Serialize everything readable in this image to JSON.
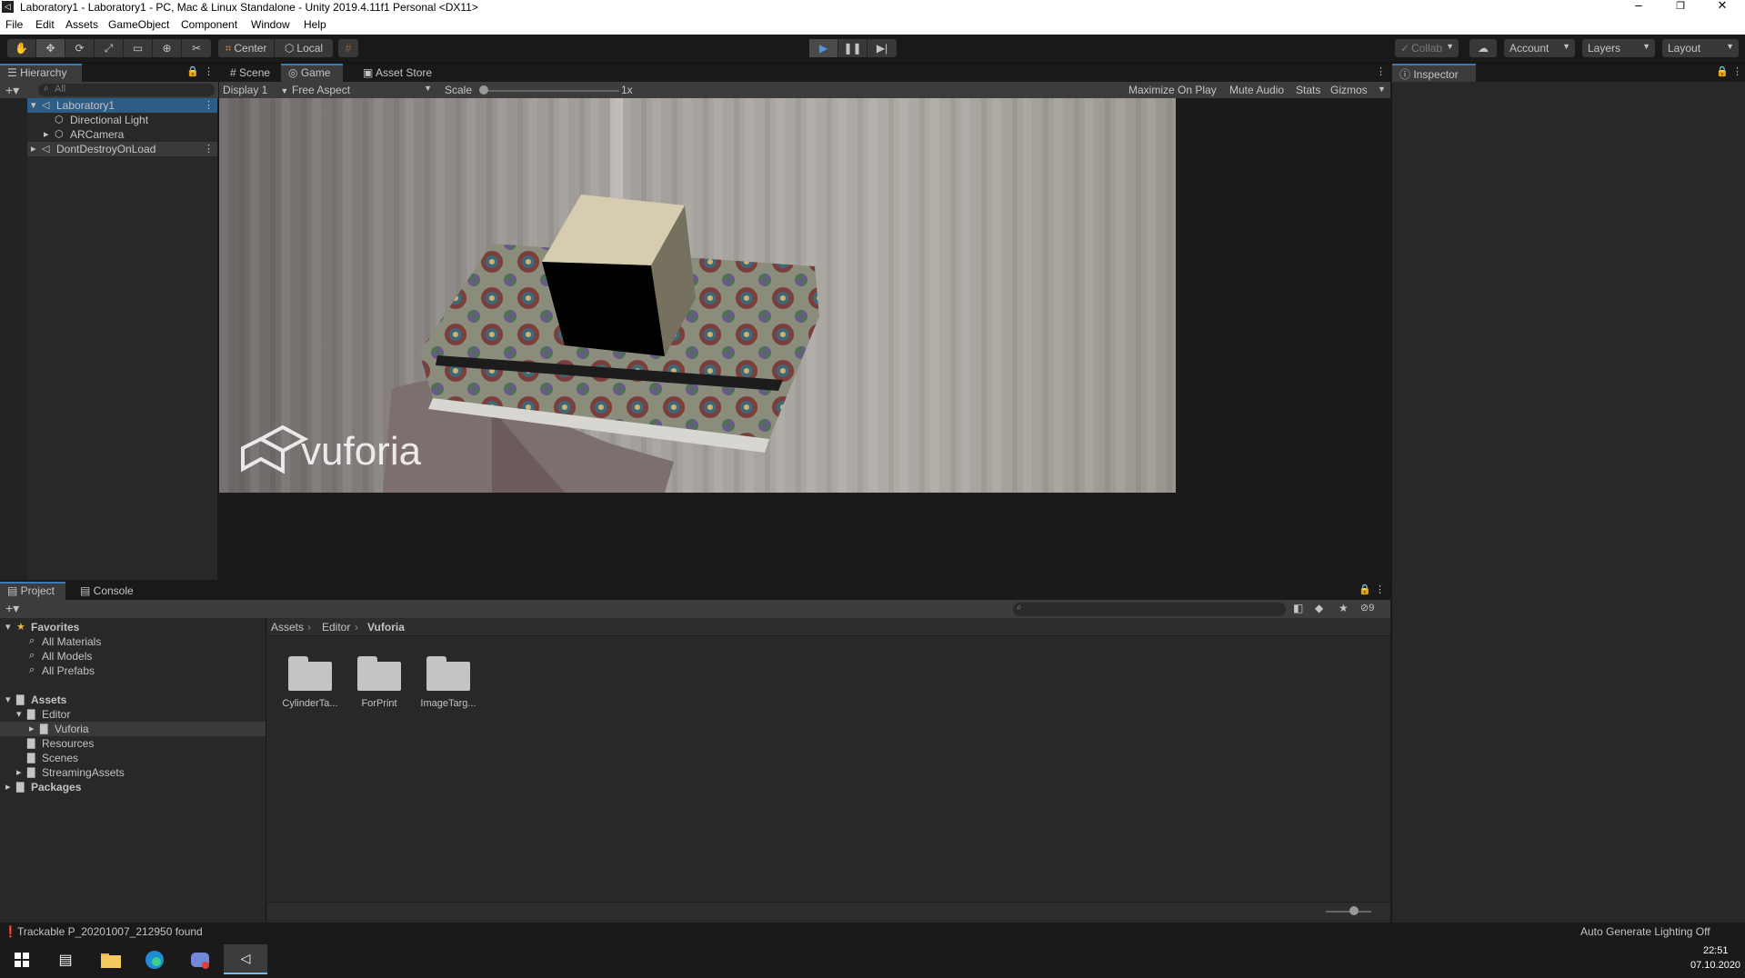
{
  "window": {
    "title": "Laboratory1 - Laboratory1 - PC, Mac & Linux Standalone - Unity 2019.4.11f1 Personal <DX11>",
    "app_icon": "◁",
    "minimize": "–",
    "restore": "❐",
    "close": "✕"
  },
  "menu": [
    "File",
    "Edit",
    "Assets",
    "GameObject",
    "Component",
    "Window",
    "Help"
  ],
  "toolbar": {
    "tools": [
      "hand-tool",
      "move-tool",
      "rotate-tool",
      "scale-tool",
      "rect-tool",
      "transform-tool",
      "custom-tool"
    ],
    "pivot": "Center",
    "space": "Local",
    "collab": "Collab",
    "account": "Account",
    "layers": "Layers",
    "layout": "Layout"
  },
  "hierarchy": {
    "tab": "Hierarchy",
    "search_placeholder": "All",
    "items": [
      {
        "label": "Laboratory1"
      },
      {
        "label": "Directional Light"
      },
      {
        "label": "ARCamera"
      },
      {
        "label": "DontDestroyOnLoad"
      }
    ]
  },
  "center_tabs": [
    "Scene",
    "Game",
    "Asset Store"
  ],
  "game_toolbar": {
    "display": "Display 1",
    "aspect": "Free Aspect",
    "scale_label": "Scale",
    "scale_value": "1x",
    "maximize": "Maximize On Play",
    "mute": "Mute Audio",
    "stats": "Stats",
    "gizmos": "Gizmos"
  },
  "game_view": {
    "watermark": "vuforia"
  },
  "inspector": {
    "tab": "Inspector"
  },
  "project": {
    "tabs": [
      "Project",
      "Console"
    ],
    "hidden_count": "9",
    "favorites": {
      "label": "Favorites",
      "items": [
        "All Materials",
        "All Models",
        "All Prefabs"
      ]
    },
    "tree": {
      "assets": "Assets",
      "editor": "Editor",
      "vuforia": "Vuforia",
      "resources": "Resources",
      "scenes": "Scenes",
      "streaming": "StreamingAssets",
      "packages": "Packages"
    },
    "breadcrumb": [
      "Assets",
      "Editor",
      "Vuforia"
    ],
    "folders": [
      "CylinderTa...",
      "ForPrint",
      "ImageTarg..."
    ]
  },
  "status": {
    "message": "Trackable P_20201007_212950 found",
    "lighting": "Auto Generate Lighting Off"
  },
  "taskbar": {
    "time": "22:51",
    "date": "07.10.2020"
  }
}
